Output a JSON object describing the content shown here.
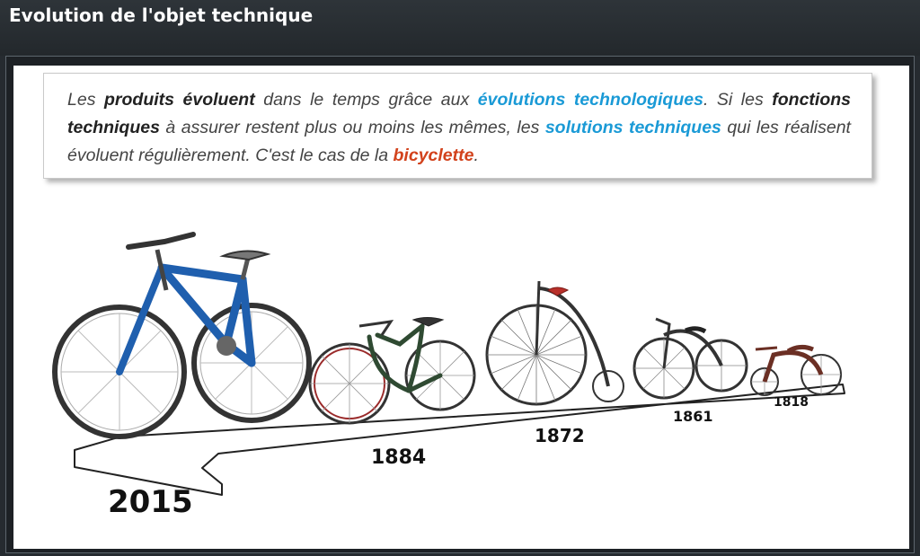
{
  "header": {
    "title": "Evolution de l'objet technique"
  },
  "intro": {
    "t1": "Les ",
    "b1": "produits évoluent",
    "t2": " dans le temps grâce aux ",
    "h1": "évolutions technologiques",
    "t3": ". Si les ",
    "b2": "fonctions techniques",
    "t4": " à assurer restent plus ou moins les mêmes, les ",
    "h2": "solutions techniques",
    "t5": " qui les réalisent évoluent régulièrement. C'est le cas de la ",
    "h3": "bicyclette",
    "t6": "."
  },
  "timeline": {
    "years": [
      "2015",
      "1884",
      "1872",
      "1861",
      "1818"
    ]
  },
  "colors": {
    "header_bg": "#2b3035",
    "accent_blue": "#1a9ad6",
    "accent_red": "#d2421c",
    "bike_2015": "#1f5fae"
  }
}
